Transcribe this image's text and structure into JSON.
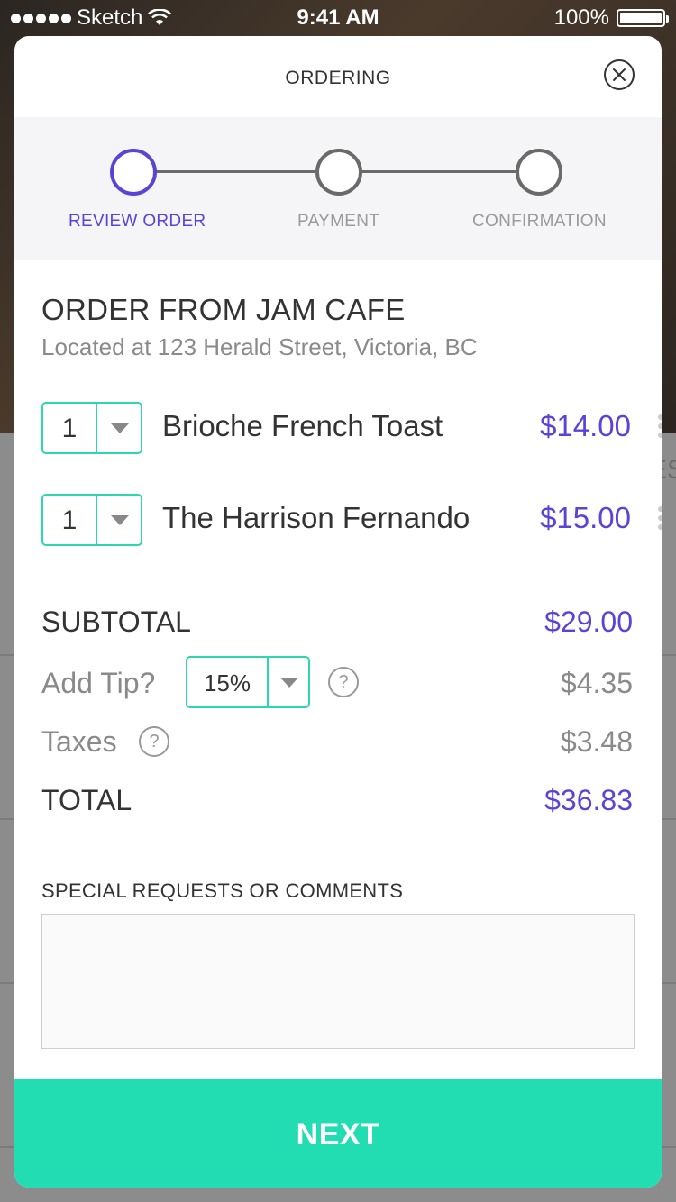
{
  "status_bar": {
    "carrier": "Sketch",
    "time": "9:41 AM",
    "battery": "100%",
    "battery_level": 1.0
  },
  "background": {
    "peek_text": "ES"
  },
  "modal": {
    "title": "ORDERING",
    "close_icon": "close-circle-icon"
  },
  "steps": [
    {
      "label": "REVIEW ORDER",
      "active": true
    },
    {
      "label": "PAYMENT",
      "active": false
    },
    {
      "label": "CONFIRMATION",
      "active": false
    }
  ],
  "colors": {
    "accent_purple": "#5a43d6",
    "accent_teal": "#22ddb2",
    "select_border": "#2bd6b0"
  },
  "restaurant": {
    "title": "ORDER FROM JAM CAFE",
    "address": "Located at 123 Herald Street, Victoria, BC"
  },
  "items": [
    {
      "qty": "1",
      "name": "Brioche French Toast",
      "price": "$14.00"
    },
    {
      "qty": "1",
      "name": "The Harrison Fernando",
      "price": "$15.00"
    }
  ],
  "summary": {
    "subtotal_label": "SUBTOTAL",
    "subtotal_value": "$29.00",
    "tip_label": "Add Tip?",
    "tip_selected": "15%",
    "tip_value": "$4.35",
    "taxes_label": "Taxes",
    "taxes_value": "$3.48",
    "total_label": "TOTAL",
    "total_value": "$36.83",
    "help_glyph": "?"
  },
  "comments": {
    "label": "SPECIAL REQUESTS OR COMMENTS",
    "value": ""
  },
  "next_button": {
    "label": "NEXT"
  }
}
